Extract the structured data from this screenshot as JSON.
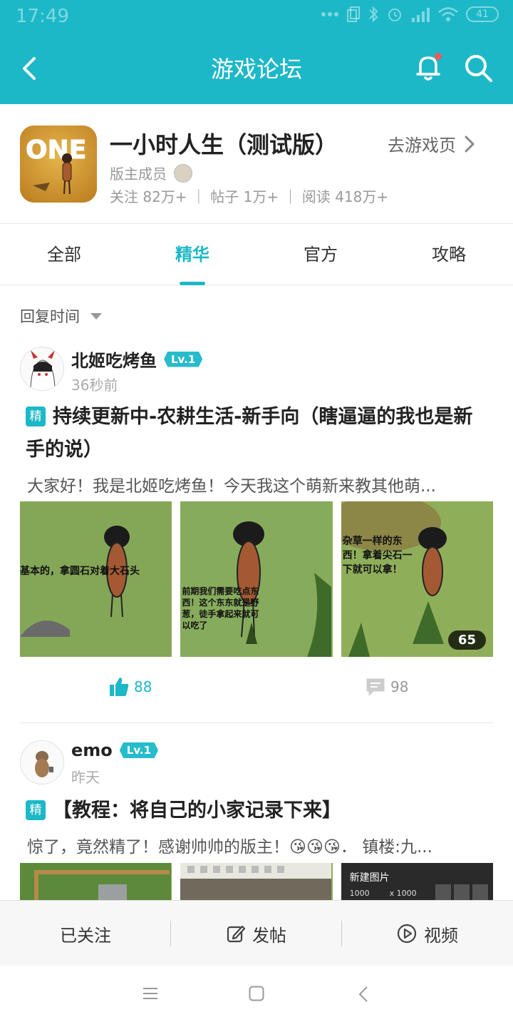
{
  "status": {
    "time": "17:49",
    "battery": "41"
  },
  "nav": {
    "title": "游戏论坛"
  },
  "game": {
    "name": "一小时人生（测试版）",
    "goto_label": "去游戏页",
    "moderator_label": "版主成员",
    "stats": "关注 82万+ ｜ 帖子 1万+ ｜ 阅读 418万+",
    "icon_text": "ONE"
  },
  "tabs": [
    {
      "label": "全部"
    },
    {
      "label": "精华"
    },
    {
      "label": "官方"
    },
    {
      "label": "攻略"
    }
  ],
  "active_tab": "精华",
  "sort": {
    "label": "回复时间"
  },
  "posts": [
    {
      "author": "北姬吃烤鱼",
      "level": "Lv.1",
      "time": "36秒前",
      "badge": "精",
      "title": "持续更新中-农耕生活-新手向（瞎逼逼的我也是新手的说）",
      "excerpt": "大家好！我是北姬吃烤鱼！今天我这个萌新来教其他萌...",
      "image_captions": [
        "基本的，拿圆石对着大石头",
        "前期我们需要吃点东西！这个东东就是野葱，徒手拿起来就可以吃了",
        "杂草一样的东西！拿着尖石一下就可以拿！"
      ],
      "image_count": "65",
      "likes": "88",
      "comments": "98"
    },
    {
      "author": "emo",
      "level": "Lv.1",
      "time": "昨天",
      "badge": "精",
      "title": "【教程：将自己的小家记录下来】",
      "excerpt": "惊了，竟然精了！感谢帅帅的版主！😘😘😘．  镇楼:九...",
      "image3_title": "新建图片",
      "image3_w": "1000",
      "image3_x": "x 1000"
    }
  ],
  "bottom": [
    {
      "label": "已关注"
    },
    {
      "label": "发帖"
    },
    {
      "label": "视频"
    }
  ],
  "colors": {
    "accent": "#1cb8c8"
  }
}
